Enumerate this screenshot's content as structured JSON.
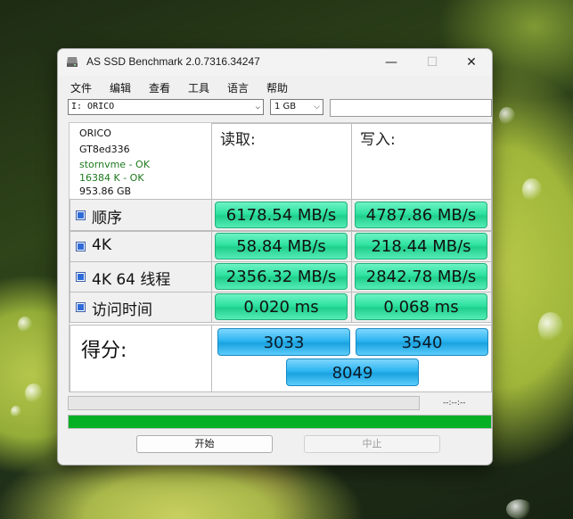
{
  "window": {
    "title": "AS SSD Benchmark 2.0.7316.34247"
  },
  "menu": [
    "文件",
    "编辑",
    "查看",
    "工具",
    "语言",
    "帮助"
  ],
  "drive_select": {
    "value": "I: ORICO"
  },
  "size_select": {
    "value": "1 GB"
  },
  "drive_info": {
    "name": "ORICO",
    "firmware": "GT8ed336",
    "driver": "stornvme - OK",
    "alignment": "16384 K - OK",
    "capacity": "953.86 GB"
  },
  "columns": {
    "read": "读取:",
    "write": "写入:"
  },
  "rows": [
    {
      "label": "顺序",
      "read": "6178.54 MB/s",
      "write": "4787.86 MB/s",
      "checked": true
    },
    {
      "label": "4K",
      "read": "58.84 MB/s",
      "write": "218.44 MB/s",
      "checked": true
    },
    {
      "label": "4K 64 线程",
      "read": "2356.32 MB/s",
      "write": "2842.78 MB/s",
      "checked": true
    },
    {
      "label": "访问时间",
      "read": "0.020 ms",
      "write": "0.068 ms",
      "checked": true
    }
  ],
  "score": {
    "label": "得分:",
    "read": "3033",
    "write": "3540",
    "total": "8049"
  },
  "status": {
    "timer": "--:--:--",
    "progress_fraction": 1.0,
    "progress_color": "#06b025"
  },
  "buttons": {
    "start": "开始",
    "stop": "中止"
  },
  "colors": {
    "value_green": "#2fe2a0",
    "score_blue": "#2db5f0"
  }
}
